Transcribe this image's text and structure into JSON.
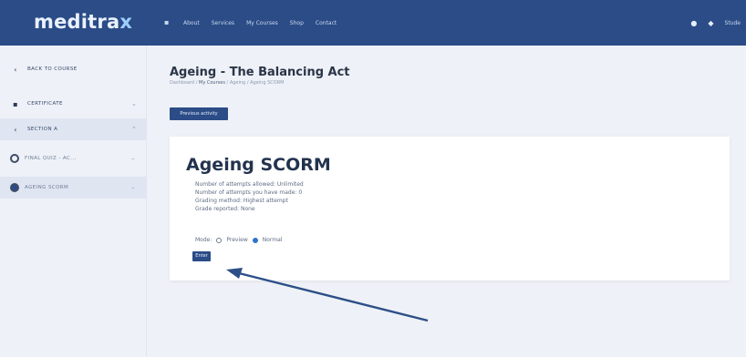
{
  "header": {
    "logo_main": "meditra",
    "logo_x": "x",
    "nav": [
      "About",
      "Services",
      "My Courses",
      "Shop",
      "Contact"
    ],
    "user_label": "Stude"
  },
  "sidebar": {
    "items": [
      {
        "label": "Back to course"
      },
      {
        "label": "Certificate"
      },
      {
        "label": "Section A"
      },
      {
        "label": "Final quiz - AC..."
      },
      {
        "label": "Ageing SCORM"
      }
    ]
  },
  "main": {
    "title": "Ageing - The Balancing Act",
    "breadcrumb": {
      "home": "Dashboard",
      "sep": " / ",
      "courses": "My Courses",
      "course": "Ageing",
      "activity": "Ageing SCORM"
    },
    "prev_button": "Previous activity"
  },
  "scorm": {
    "title": "Ageing SCORM",
    "info": [
      "Number of attempts allowed: Unlimited",
      "Number of attempts you have made: 0",
      "Grading method: Highest attempt",
      "Grade reported: None"
    ],
    "mode_label": "Mode:",
    "mode_preview": "Preview",
    "mode_normal": "Normal",
    "selected_mode": "Normal",
    "enter_button": "Enter"
  },
  "annotation": {
    "color": "#2c4f86"
  }
}
